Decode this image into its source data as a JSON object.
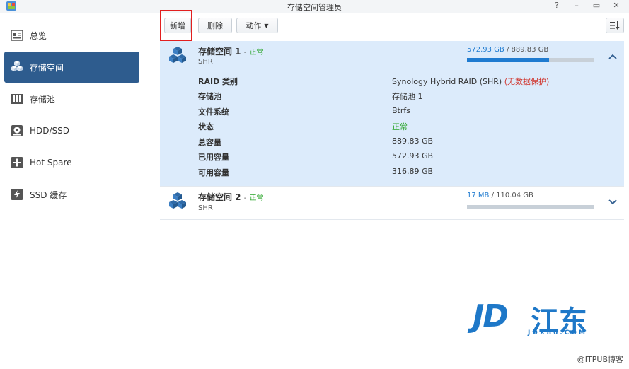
{
  "window": {
    "title": "存储空间管理员",
    "controls": [
      "?",
      "–",
      "▭",
      "✕"
    ],
    "app_icon": "storage-manager-icon"
  },
  "sidebar": {
    "items": [
      {
        "label": "总览",
        "icon": "overview-icon",
        "active": false
      },
      {
        "label": "存储空间",
        "icon": "volume-icon",
        "active": true
      },
      {
        "label": "存储池",
        "icon": "storage-pool-icon",
        "active": false
      },
      {
        "label": "HDD/SSD",
        "icon": "disk-icon",
        "active": false
      },
      {
        "label": "Hot Spare",
        "icon": "hot-spare-icon",
        "active": false
      },
      {
        "label": "SSD 缓存",
        "icon": "ssd-cache-icon",
        "active": false
      }
    ]
  },
  "toolbar": {
    "create_label": "新增",
    "delete_label": "删除",
    "action_label": "动作",
    "sort_icon": "sort-icon"
  },
  "volumes": [
    {
      "name": "存储空间 1",
      "separator": "-",
      "status": "正常",
      "type": "SHR",
      "used": "572.93 GB",
      "slash": " / ",
      "total": "889.83 GB",
      "usage_fraction": 0.644,
      "expanded": true,
      "details": [
        {
          "label": "RAID 类别",
          "value": "Synology Hybrid RAID (SHR)",
          "note": "(无数据保护)"
        },
        {
          "label": "存储池",
          "value": "存储池 1"
        },
        {
          "label": "文件系统",
          "value": "Btrfs"
        },
        {
          "label": "状态",
          "value": "正常"
        },
        {
          "label": "总容量",
          "value": "889.83 GB"
        },
        {
          "label": "已用容量",
          "value": "572.93 GB"
        },
        {
          "label": "可用容量",
          "value": "316.89 GB"
        }
      ]
    },
    {
      "name": "存储空间 2",
      "separator": "-",
      "status": "正常",
      "type": "SHR",
      "used": "17 MB",
      "slash": " / ",
      "total": "110.04 GB",
      "usage_fraction": 0.0002,
      "expanded": false
    }
  ],
  "watermark": {
    "main": "JD",
    "cn": "江东",
    "sub": "JDX86.COM"
  },
  "credit": "@ITPUB博客",
  "colors": {
    "accent": "#2e5c8e",
    "selected_panel": "#dcebfb",
    "usage_fill": "#1f7bd0",
    "status_ok": "#2aa52a",
    "warning": "#d0342c",
    "highlight": "#e21f1f"
  }
}
